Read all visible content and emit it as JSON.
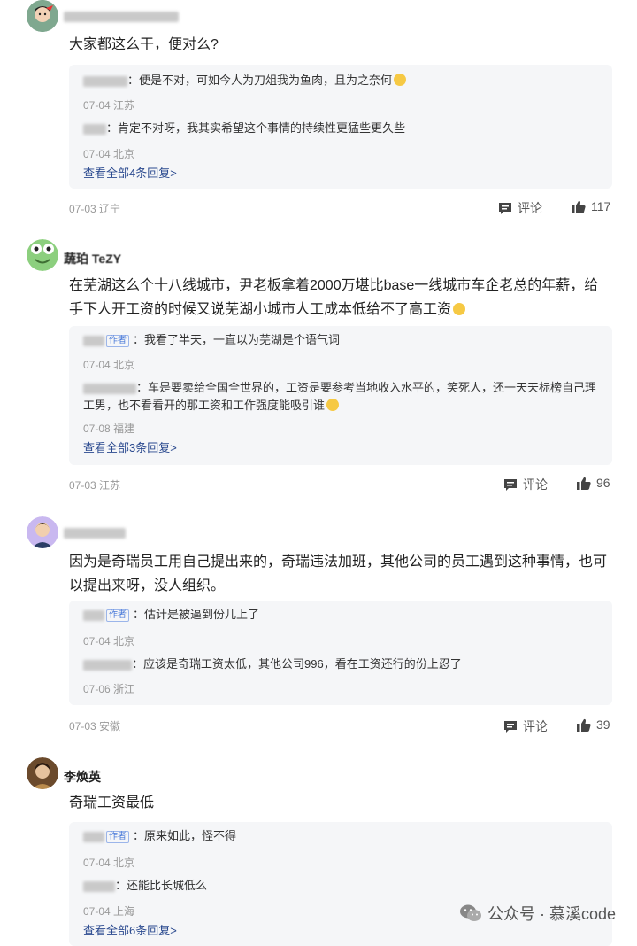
{
  "comments": [
    {
      "username": "",
      "text": "大家都这么干，便对么?",
      "replies": [
        {
          "name_suffix": "",
          "text": "：便是不对，可如今人为刀俎我为鱼肉，且为之奈何",
          "meta": "07-04 江苏"
        },
        {
          "name_suffix": "",
          "text": "：肯定不对呀，我其实希望这个事情的持续性更猛些更久些",
          "meta": "07-04 北京"
        }
      ],
      "view_all": "查看全部4条回复>",
      "meta": "07-03 辽宁",
      "comment_label": "评论",
      "likes": "117"
    },
    {
      "username": "蔬珀 TeZY",
      "text": "在芜湖这么个十八线城市，尹老板拿着2000万堪比base一线城市车企老总的年薪，给手下人开工资的时候又说芜湖小城市人工成本低给不了高工资",
      "replies": [
        {
          "tag": "作者",
          "text": "：我看了半天，一直以为芜湖是个语气词",
          "meta": "07-04 北京"
        },
        {
          "text": "：车是要卖给全国全世界的，工资是要参考当地收入水平的，笑死人，还一天天标榜自己理工男，也不看看开的那工资和工作强度能吸引谁",
          "meta": "07-08 福建"
        }
      ],
      "view_all": "查看全部3条回复>",
      "meta": "07-03 江苏",
      "comment_label": "评论",
      "likes": "96"
    },
    {
      "username": "",
      "text": "因为是奇瑞员工用自己提出来的，奇瑞违法加班，其他公司的员工遇到这种事情，也可以提出来呀，没人组织。",
      "replies": [
        {
          "tag": "作者",
          "text": "：估计是被逼到份儿上了",
          "meta": "07-04 北京"
        },
        {
          "text": "：应该是奇瑞工资太低，其他公司996，看在工资还行的份上忍了",
          "meta": "07-06 浙江"
        }
      ],
      "meta": "07-03 安徽",
      "comment_label": "评论",
      "likes": "39"
    },
    {
      "username": "李焕英",
      "text": "奇瑞工资最低",
      "replies": [
        {
          "tag": "作者",
          "text": "：原来如此，怪不得",
          "meta": "07-04 北京"
        },
        {
          "text": "：还能比长城低么",
          "meta": "07-04 上海"
        }
      ],
      "view_all": "查看全部6条回复>"
    }
  ],
  "watermark": "公众号 · 慕溪code"
}
